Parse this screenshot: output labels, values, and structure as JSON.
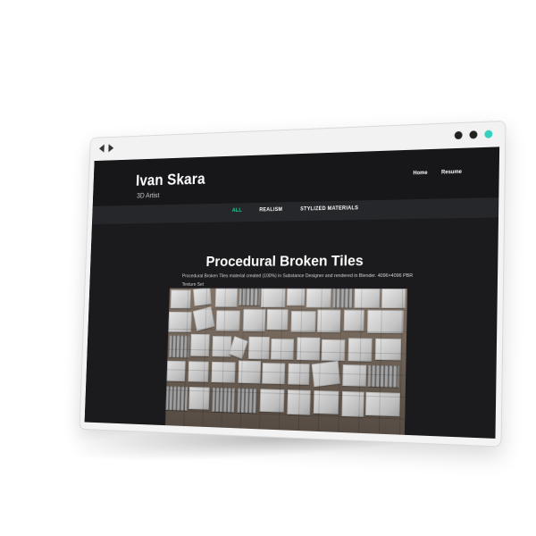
{
  "brand": {
    "name": "Ivan Skara",
    "subtitle": "3D Artist"
  },
  "nav": {
    "home": "Home",
    "resume": "Resume"
  },
  "filters": {
    "all": "ALL",
    "realism": "REALISM",
    "stylized": "STYLIZED MATERIALS"
  },
  "project": {
    "title": "Procedural Broken Tiles",
    "description": "Procedural Broken Tiles material created (100%) in Substance Designer and rendered in Blender. 4096×4096 PBR Texture Set"
  },
  "colors": {
    "page_bg": "#1b1b1d",
    "header_bg": "#17171a",
    "filter_bg": "#26272a",
    "accent": "#27d39d",
    "teal_dot": "#34d1c0"
  }
}
